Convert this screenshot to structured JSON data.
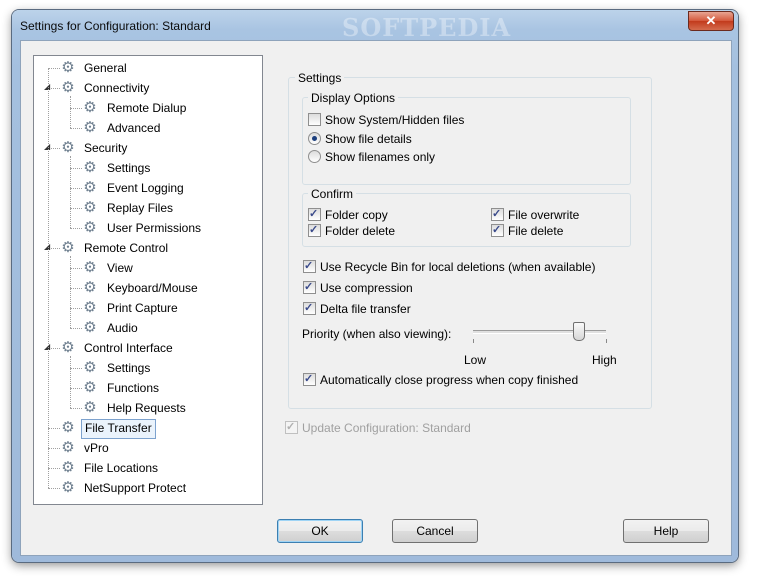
{
  "window": {
    "title": "Settings for Configuration: Standard",
    "watermark": "SOFTPEDIA",
    "close_glyph": "✕"
  },
  "tree": {
    "items": [
      {
        "label": "General",
        "level": 0,
        "selected": false,
        "expandable": false
      },
      {
        "label": "Connectivity",
        "level": 0,
        "selected": false,
        "expandable": true
      },
      {
        "label": "Remote Dialup",
        "level": 1,
        "selected": false,
        "expandable": false
      },
      {
        "label": "Advanced",
        "level": 1,
        "selected": false,
        "expandable": false
      },
      {
        "label": "Security",
        "level": 0,
        "selected": false,
        "expandable": true
      },
      {
        "label": "Settings",
        "level": 1,
        "selected": false,
        "expandable": false
      },
      {
        "label": "Event Logging",
        "level": 1,
        "selected": false,
        "expandable": false
      },
      {
        "label": "Replay Files",
        "level": 1,
        "selected": false,
        "expandable": false
      },
      {
        "label": "User Permissions",
        "level": 1,
        "selected": false,
        "expandable": false
      },
      {
        "label": "Remote Control",
        "level": 0,
        "selected": false,
        "expandable": true
      },
      {
        "label": "View",
        "level": 1,
        "selected": false,
        "expandable": false
      },
      {
        "label": "Keyboard/Mouse",
        "level": 1,
        "selected": false,
        "expandable": false
      },
      {
        "label": "Print Capture",
        "level": 1,
        "selected": false,
        "expandable": false
      },
      {
        "label": "Audio",
        "level": 1,
        "selected": false,
        "expandable": false
      },
      {
        "label": "Control Interface",
        "level": 0,
        "selected": false,
        "expandable": true
      },
      {
        "label": "Settings",
        "level": 1,
        "selected": false,
        "expandable": false
      },
      {
        "label": "Functions",
        "level": 1,
        "selected": false,
        "expandable": false
      },
      {
        "label": "Help Requests",
        "level": 1,
        "selected": false,
        "expandable": false
      },
      {
        "label": "File Transfer",
        "level": 0,
        "selected": true,
        "expandable": false
      },
      {
        "label": "vPro",
        "level": 0,
        "selected": false,
        "expandable": false
      },
      {
        "label": "File Locations",
        "level": 0,
        "selected": false,
        "expandable": false
      },
      {
        "label": "NetSupport Protect",
        "level": 0,
        "selected": false,
        "expandable": false
      }
    ],
    "item_icon": "gear-icon",
    "expander_glyph": "◢"
  },
  "settings": {
    "title": "Settings",
    "display_options": {
      "title": "Display Options",
      "show_hidden": {
        "label": "Show System/Hidden files",
        "checked": false
      },
      "show_details": {
        "label": "Show file details",
        "checked": true
      },
      "show_names": {
        "label": "Show filenames only",
        "checked": false
      }
    },
    "confirm": {
      "title": "Confirm",
      "folder_copy": {
        "label": "Folder copy",
        "checked": true
      },
      "file_overwrite": {
        "label": "File overwrite",
        "checked": true
      },
      "folder_delete": {
        "label": "Folder delete",
        "checked": true
      },
      "file_delete": {
        "label": "File delete",
        "checked": true
      }
    },
    "recycle_bin": {
      "label": "Use Recycle Bin for local deletions (when available)",
      "checked": true
    },
    "compression": {
      "label": "Use compression",
      "checked": true
    },
    "delta": {
      "label": "Delta file transfer",
      "checked": true
    },
    "priority": {
      "label": "Priority (when also viewing):",
      "low": "Low",
      "high": "High",
      "level": 0.8
    },
    "auto_close": {
      "label": "Automatically close progress when copy finished",
      "checked": true
    }
  },
  "update_config": {
    "label": "Update Configuration: Standard",
    "checked": true,
    "enabled": false
  },
  "buttons": {
    "ok": "OK",
    "cancel": "Cancel",
    "help": "Help"
  }
}
